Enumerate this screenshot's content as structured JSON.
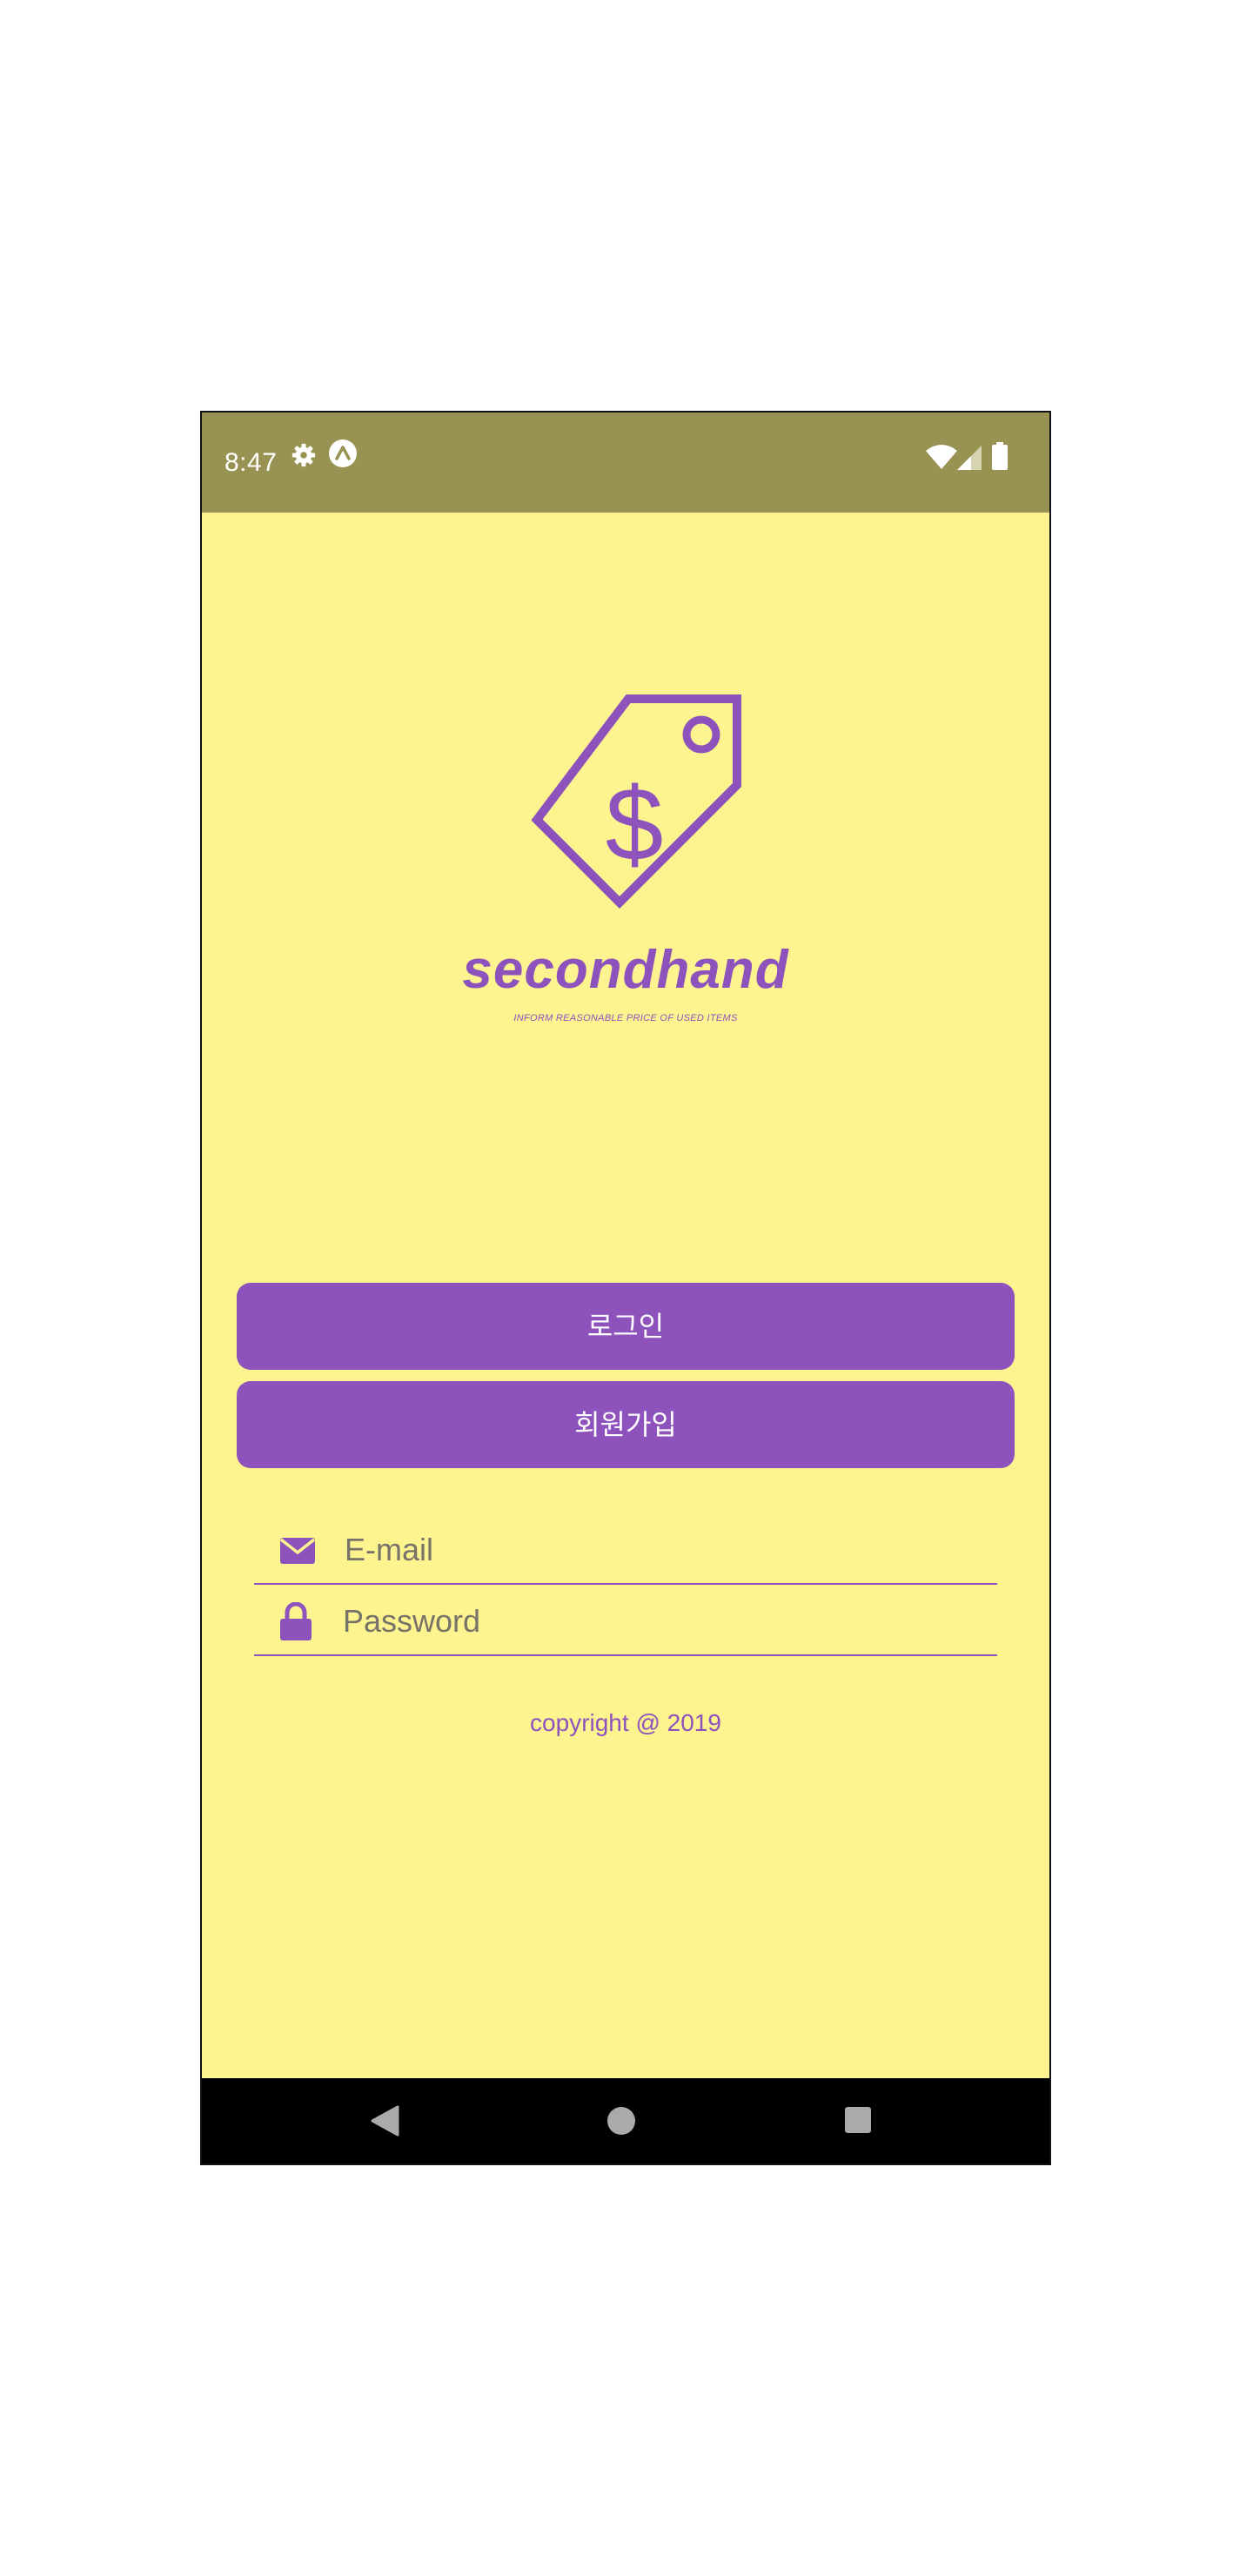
{
  "status_bar": {
    "time": "8:47",
    "icons": [
      "gear-icon",
      "navigation-arrow-icon",
      "wifi-icon",
      "cell-signal-icon",
      "battery-icon"
    ]
  },
  "brand": {
    "logo_icon": "price-tag-dollar-icon",
    "name": "secondhand",
    "tagline": "INFORM REASONABLE PRICE OF USED ITEMS"
  },
  "form": {
    "email_icon": "envelope-icon",
    "email_placeholder": "E-mail",
    "email_value": "",
    "password_icon": "lock-icon",
    "password_placeholder": "Password",
    "password_value": ""
  },
  "buttons": {
    "login_label": "로그인",
    "signup_label": "회원가입"
  },
  "footer": {
    "copyright": "copyright @ 2019"
  },
  "nav_bar": {
    "icons": [
      "back-triangle-icon",
      "home-circle-icon",
      "recents-square-icon"
    ]
  },
  "colors": {
    "status_bar": "#989352",
    "background": "#fdf48f",
    "accent": "#8e52bd",
    "nav_bar": "#000000"
  }
}
